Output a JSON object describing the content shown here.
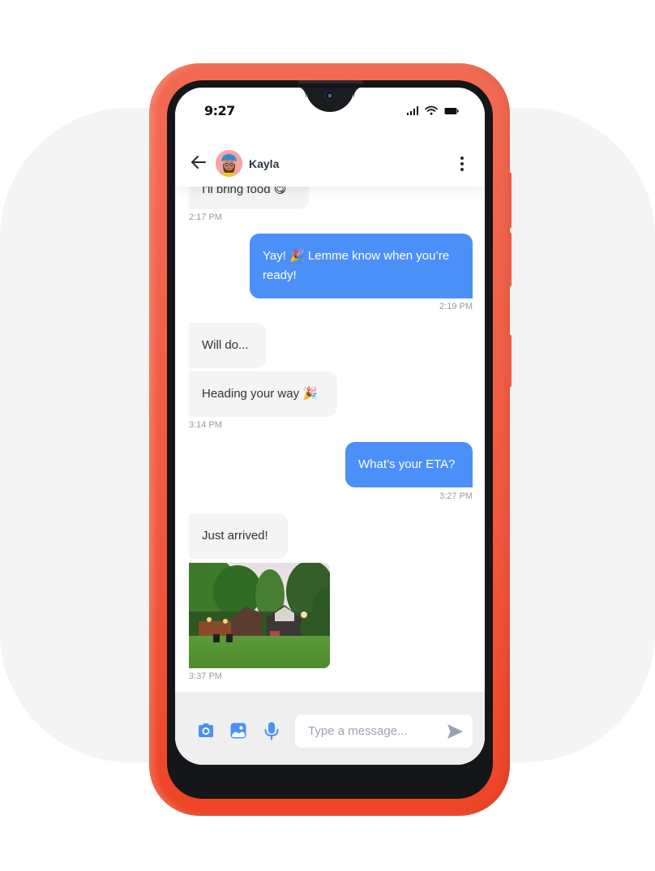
{
  "status_bar": {
    "time": "9:27",
    "icons": [
      "signal-icon",
      "wifi-icon",
      "battery-icon"
    ]
  },
  "header": {
    "contact_name": "Kayla",
    "back_icon": "arrow-left-icon",
    "menu_icon": "more-vertical-icon"
  },
  "messages": [
    {
      "direction": "in",
      "text": "I'll bring food 😋",
      "time": "2:17 PM"
    },
    {
      "direction": "out",
      "text": "Yay! 🎉 Lemme know when you’re ready!",
      "time": "2:19 PM"
    },
    {
      "direction": "in",
      "text": "Will do..."
    },
    {
      "direction": "in",
      "text": "Heading your way 🎉",
      "time": "3:14 PM"
    },
    {
      "direction": "out",
      "text": "What’s your ETA?",
      "time": "3:27 PM"
    },
    {
      "direction": "in",
      "text": "Just arrived!"
    },
    {
      "direction": "in",
      "type": "image",
      "alt": "Photo of a cabin with string lights and a lawn",
      "time": "3:37 PM"
    }
  ],
  "composer": {
    "placeholder": "Type a message...",
    "value": "",
    "icons": [
      "camera-icon",
      "image-icon",
      "microphone-icon",
      "send-icon"
    ]
  },
  "colors": {
    "accent": "#4b90f8",
    "case": "#f1583f",
    "incoming_bubble": "#f4f4f5",
    "composer_bg": "#efefef"
  }
}
